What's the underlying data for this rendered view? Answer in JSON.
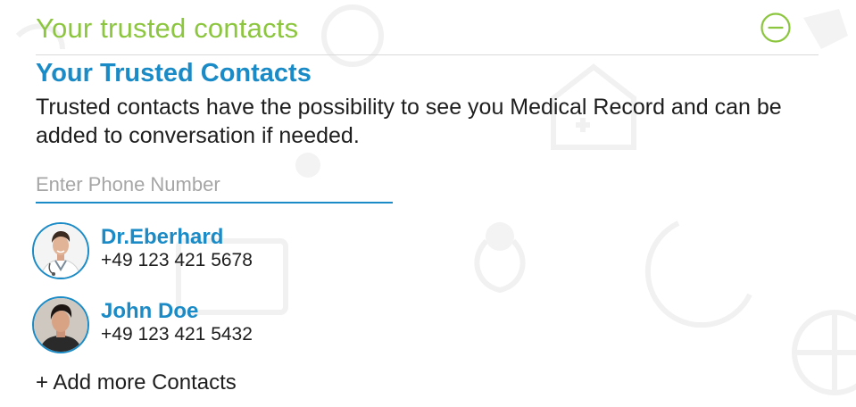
{
  "section": {
    "title": "Your trusted contacts",
    "collapse_icon": "minus-circle-icon"
  },
  "heading": "Your Trusted Contacts",
  "description": "Trusted contacts have the possibility to see you Medical Record and can be added to conversation if needed.",
  "phone_input": {
    "placeholder": "Enter Phone Number",
    "value": ""
  },
  "contacts": [
    {
      "name": "Dr.Eberhard",
      "phone": "+49 123 421 5678",
      "avatar": "doctor-avatar"
    },
    {
      "name": "John Doe",
      "phone": "+49 123 421 5432",
      "avatar": "man-avatar"
    }
  ],
  "add_more": "+ Add more Contacts",
  "colors": {
    "accent_green": "#8cc63f",
    "accent_blue": "#1a8bc6",
    "text": "#1e1e1e",
    "placeholder": "#a6a6a6",
    "divider": "#d9d9d9"
  }
}
